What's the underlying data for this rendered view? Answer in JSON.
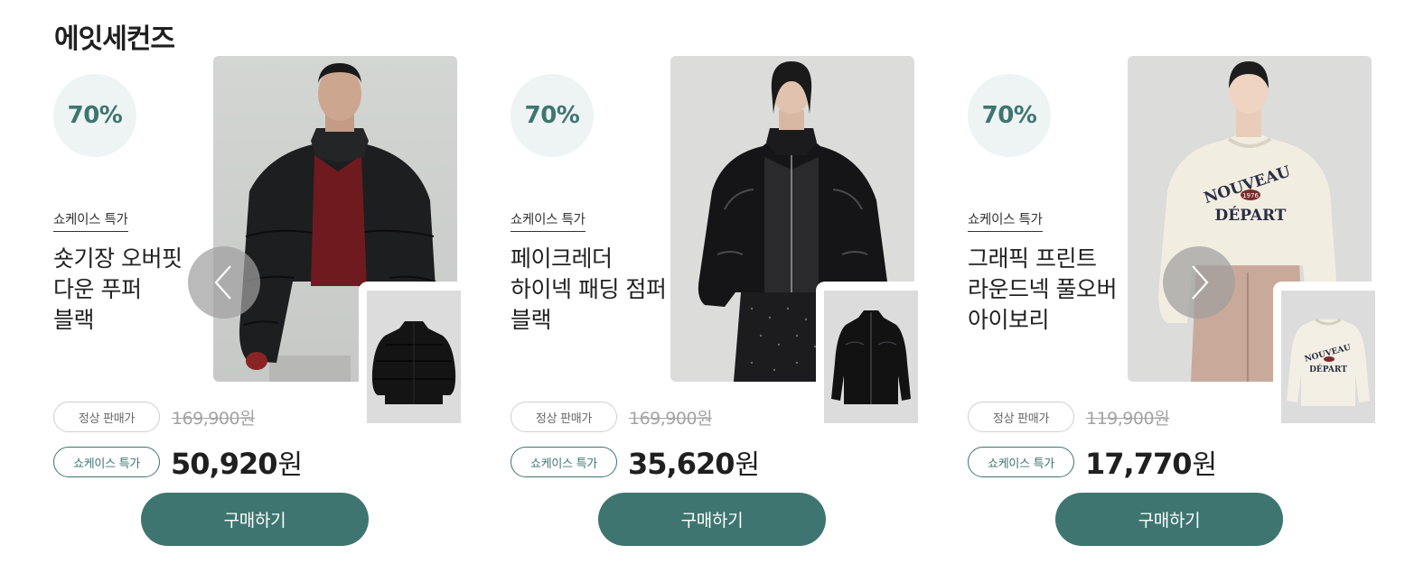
{
  "brand": {
    "title": "에잇세컨즈"
  },
  "carousel": {
    "prev_icon": "chevron-left-icon",
    "next_icon": "chevron-right-icon"
  },
  "products": [
    {
      "discount": "70%",
      "event_label": "쇼케이스 특가",
      "name_lines": [
        "숏기장 오버핏",
        "다운 푸퍼",
        "블랙"
      ],
      "regular_label": "정상 판매가",
      "regular_price": "169,900원",
      "sale_label": "쇼케이스 특가",
      "sale_price": "50,920",
      "sale_unit": "원",
      "buy_label": "구매하기"
    },
    {
      "discount": "70%",
      "event_label": "쇼케이스 특가",
      "name_lines": [
        "페이크레더",
        "하이넥 패딩 점퍼",
        "블랙"
      ],
      "regular_label": "정상 판매가",
      "regular_price": "169,900원",
      "sale_label": "쇼케이스 특가",
      "sale_price": "35,620",
      "sale_unit": "원",
      "buy_label": "구매하기"
    },
    {
      "discount": "70%",
      "event_label": "쇼케이스 특가",
      "name_lines": [
        "그래픽 프린트",
        "라운드넥 풀오버",
        "아이보리"
      ],
      "regular_label": "정상 판매가",
      "regular_price": "119,900원",
      "sale_label": "쇼케이스 특가",
      "sale_price": "17,770",
      "sale_unit": "원",
      "buy_label": "구매하기",
      "print_text": {
        "top": "NOUVEAU",
        "year": "1976",
        "bottom": "DÉPART"
      }
    }
  ],
  "colors": {
    "accent": "#3e7570",
    "badge_bg": "#eef3f4",
    "strike": "#a3a3a3"
  }
}
